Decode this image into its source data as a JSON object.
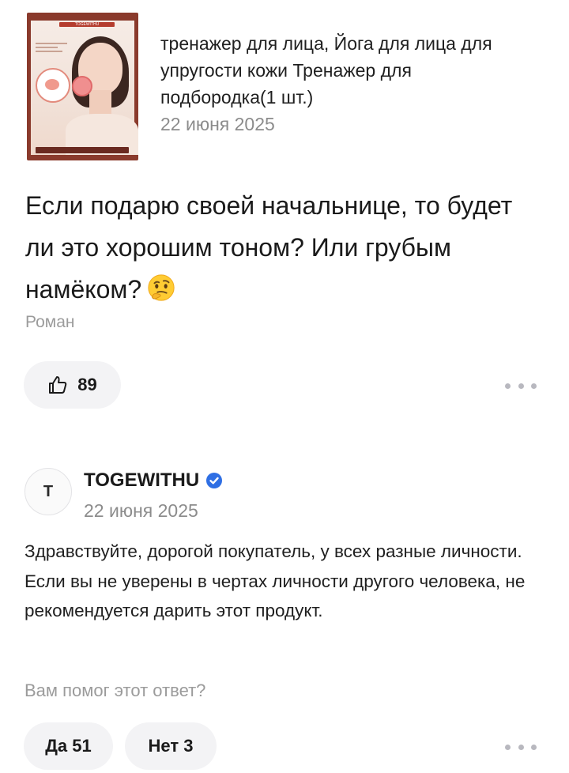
{
  "product": {
    "title": "тренажер для лица, Йога для лица для упругости кожи Тренажер для подбородка(1 шт.)",
    "date": "22 июня 2025",
    "image_brand": "TOGEWITHU"
  },
  "question": {
    "text": "Если подарю своей начальнице, то будет ли это хорошим тоном? Или грубым намёком?",
    "emoji": "thinking-face",
    "author": "Роман",
    "likes": "89"
  },
  "answer": {
    "avatar_letter": "T",
    "seller_name": "TOGEWITHU",
    "verified_color": "#2f6fe4",
    "date": "22 июня 2025",
    "text": "Здравствуйте, дорогой покупатель, у всех разные личности. Если вы не уверены в чертах личности другого человека, не рекомендуется дарить этот продукт.",
    "helpful_question": "Вам помог этот ответ?",
    "yes_label": "Да 51",
    "no_label": "Нет 3"
  },
  "icons": {
    "like": "thumbs-up-icon",
    "more": "more-dots-icon",
    "verified": "verified-check-icon"
  }
}
